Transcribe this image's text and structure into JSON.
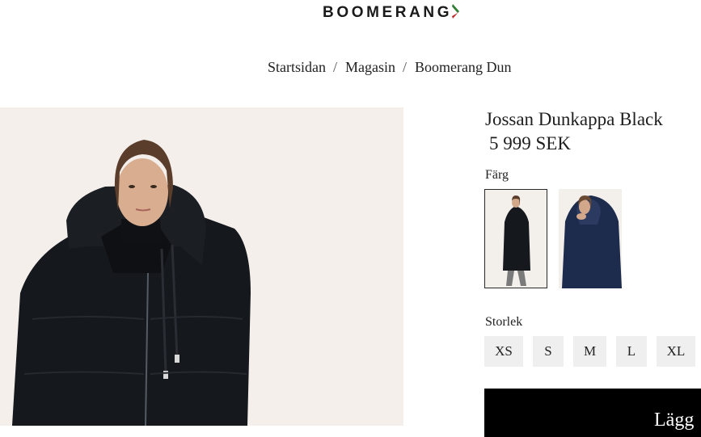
{
  "header": {
    "logo_text": "BOOMERANG"
  },
  "breadcrumb": {
    "items": [
      "Startsidan",
      "Magasin",
      "Boomerang Dun"
    ],
    "separator": "/"
  },
  "product": {
    "title": "Jossan Dunkappa Black",
    "price": "5 999 SEK",
    "color_label": "Färg",
    "colors": [
      {
        "name": "Black",
        "selected": true
      },
      {
        "name": "Navy",
        "selected": false
      }
    ],
    "size_label": "Storlek",
    "sizes": [
      "XS",
      "S",
      "M",
      "L",
      "XL"
    ],
    "add_to_cart_label": "Lägg"
  },
  "colors": {
    "brand_text": "#1a1a1a",
    "logo_accent_green": "#2e7d32",
    "logo_accent_red": "#c62828",
    "button_bg": "#000000",
    "size_bg": "#efefef",
    "image_bg": "#f4efea"
  }
}
